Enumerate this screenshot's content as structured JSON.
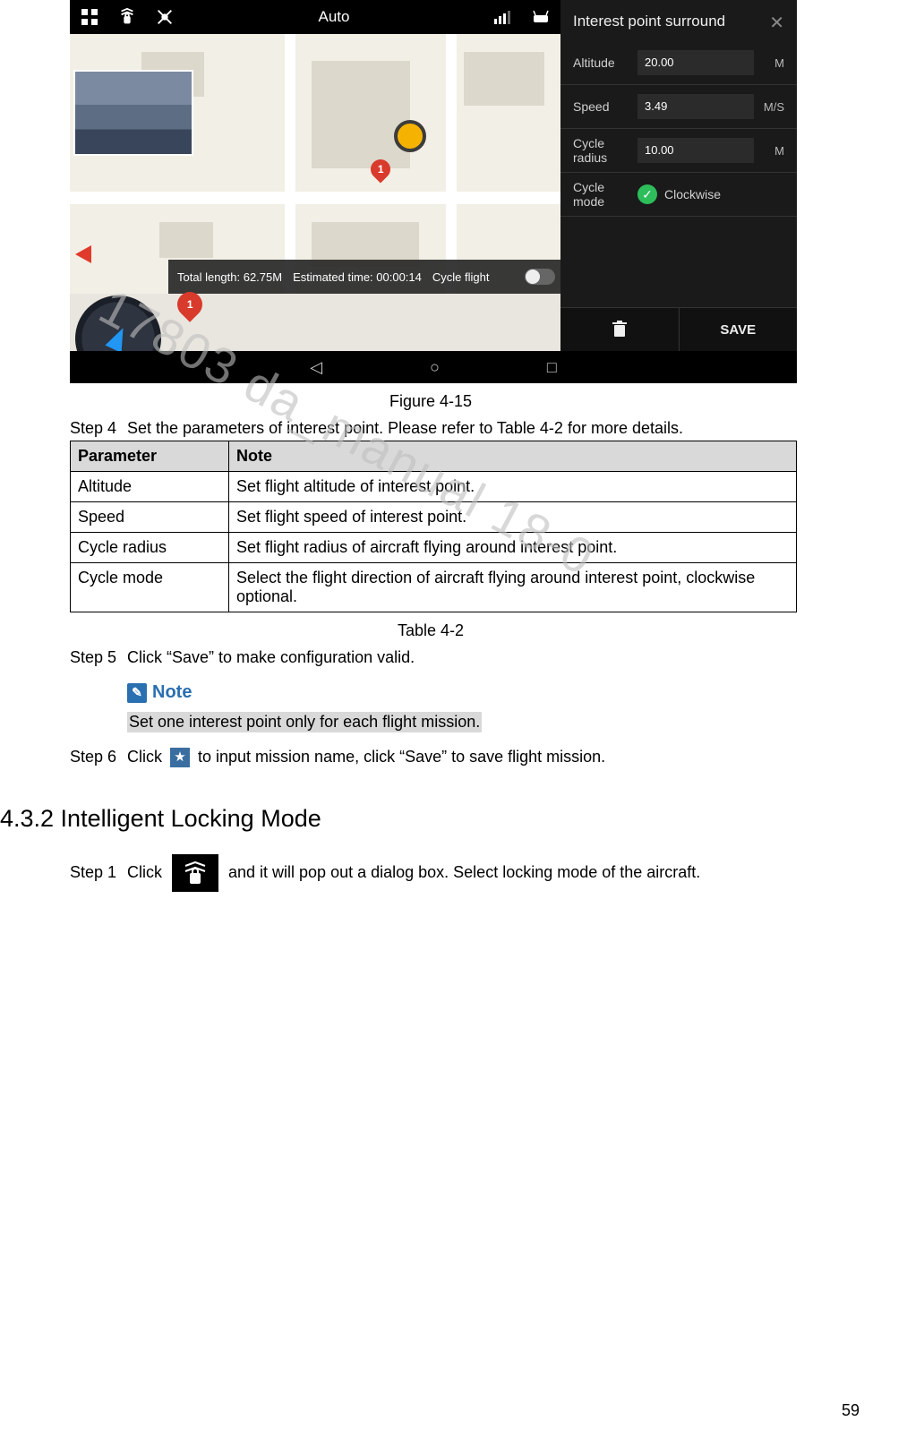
{
  "screenshot": {
    "status_bar": {
      "mode": "Auto"
    },
    "info": {
      "total_length": "Total length: 62.75M",
      "est_time": "Estimated time: 00:00:14",
      "cycle": "Cycle flight"
    },
    "pins": {
      "map_pin": "1",
      "mini_pin": "1"
    },
    "panel": {
      "title": "Interest point surround",
      "rows": [
        {
          "label": "Altitude",
          "value": "20.00",
          "unit": "M"
        },
        {
          "label": "Speed",
          "value": "3.49",
          "unit": "M/S"
        },
        {
          "label": "Cycle radius",
          "value": "10.00",
          "unit": "M"
        }
      ],
      "mode_row": {
        "label": "Cycle mode",
        "value": "Clockwise"
      },
      "save": "SAVE"
    }
  },
  "captions": {
    "figure": "Figure 4-15",
    "table": "Table 4-2"
  },
  "steps": {
    "s4": {
      "label": "Step 4",
      "text": "Set the parameters of interest point. Please refer to Table 4-2 for more details."
    },
    "s5": {
      "label": "Step 5",
      "text": "Click “Save” to make configuration valid."
    },
    "s6": {
      "label": "Step 6",
      "pre": "Click ",
      "post": " to input mission name, click “Save” to save flight mission."
    },
    "s1": {
      "label": "Step 1",
      "pre": "Click ",
      "post": " and it will pop out a dialog box. Select locking mode of the aircraft."
    }
  },
  "table": {
    "headers": {
      "param": "Parameter",
      "note": "Note"
    },
    "rows": [
      {
        "param": "Altitude",
        "note": "Set flight altitude of interest point."
      },
      {
        "param": "Speed",
        "note": "Set flight speed of interest point."
      },
      {
        "param": "Cycle radius",
        "note": "Set flight radius of aircraft flying around interest point."
      },
      {
        "param": "Cycle mode",
        "note": "Select the flight direction of aircraft flying around interest point, clockwise optional."
      }
    ]
  },
  "note": {
    "label": "Note",
    "text": "Set one interest point only for each flight mission."
  },
  "heading": "4.3.2 Intelligent Locking Mode",
  "watermark": "17803   da_manual   18-0",
  "page_number": "59"
}
